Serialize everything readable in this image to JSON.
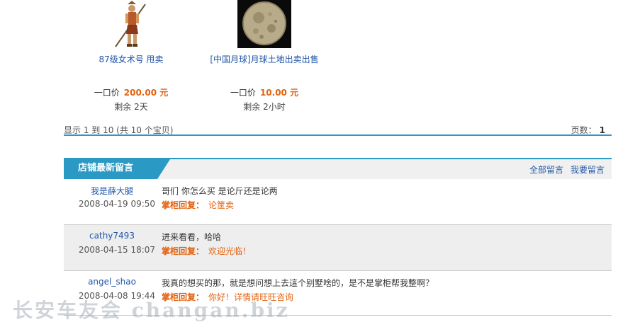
{
  "products": [
    {
      "name": "87级女术号 甩卖",
      "price_label": "一口价",
      "price": "200.00 元",
      "remain_label": "剩余",
      "remain": "2天",
      "icon": "warrior-character-image"
    },
    {
      "name": "[中国月球]月球土地出卖出售",
      "price_label": "一口价",
      "price": "10.00 元",
      "remain_label": "剩余",
      "remain": "2小时",
      "icon": "moon-image"
    }
  ],
  "pager": {
    "info": "显示 1 到 10 (共 10 个宝贝)",
    "pages_label": "页数：",
    "page": "1"
  },
  "messages_section": {
    "title": "店铺最新留言",
    "all_link": "全部留言",
    "post_link": "我要留言"
  },
  "messages": [
    {
      "user": "我是薛大腿",
      "date": "2008-04-19 09:50",
      "text": "哥们 你怎么买 是论斤还是论两",
      "reply_label": "掌柜回复：",
      "reply": "论筐卖"
    },
    {
      "user": "cathy7493",
      "date": "2008-04-15 18:07",
      "text": "进来看看，哈哈",
      "reply_label": "掌柜回复：",
      "reply": "欢迎光临！"
    },
    {
      "user": "angel_shao",
      "date": "2008-04-08 19:44",
      "text": "我真的想买的那，就是想问想上去這个别墅啥的，是不是掌柜帮我整啊？",
      "reply_label": "掌柜回复：",
      "reply": "你好！详情请旺旺咨询"
    }
  ],
  "watermark": "长安车友会 changan.biz",
  "colors": {
    "accent": "#2a9ac4",
    "price": "#e2620f",
    "link": "#2256a8"
  }
}
